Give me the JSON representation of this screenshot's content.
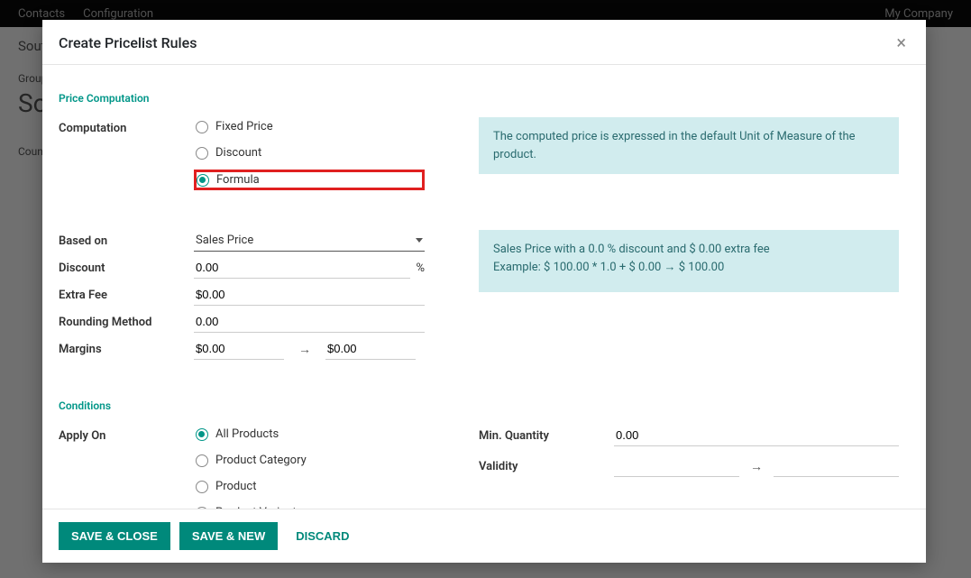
{
  "bg": {
    "nav1": "Contacts",
    "nav2": "Configuration",
    "company": "My Company",
    "breadcrumb": "South",
    "group_label": "Group N",
    "group_value": "Sou",
    "countries_label": "Countrie"
  },
  "modal": {
    "title": "Create Pricelist Rules",
    "sections": {
      "price_computation": "Price Computation",
      "conditions": "Conditions"
    },
    "labels": {
      "computation": "Computation",
      "based_on": "Based on",
      "discount": "Discount",
      "extra_fee": "Extra Fee",
      "rounding": "Rounding Method",
      "margins": "Margins",
      "apply_on": "Apply On",
      "min_qty": "Min. Quantity",
      "validity": "Validity"
    },
    "computation_options": {
      "fixed": "Fixed Price",
      "discount": "Discount",
      "formula": "Formula"
    },
    "apply_on_options": {
      "all": "All Products",
      "category": "Product Category",
      "product": "Product",
      "variant": "Product Variant"
    },
    "values": {
      "based_on": "Sales Price",
      "discount": "0.00",
      "discount_suffix": "%",
      "extra_fee": "$0.00",
      "rounding": "0.00",
      "margin_min": "$0.00",
      "margin_max": "$0.00",
      "min_qty": "0.00"
    },
    "info1": "The computed price is expressed in the default Unit of Measure of the product.",
    "info2_line1": "Sales Price with a 0.0 % discount and $ 0.00 extra fee",
    "info2_line2": "Example: $ 100.00 * 1.0 + $ 0.00 → $ 100.00",
    "buttons": {
      "save_close": "SAVE & CLOSE",
      "save_new": "SAVE & NEW",
      "discard": "DISCARD"
    }
  }
}
